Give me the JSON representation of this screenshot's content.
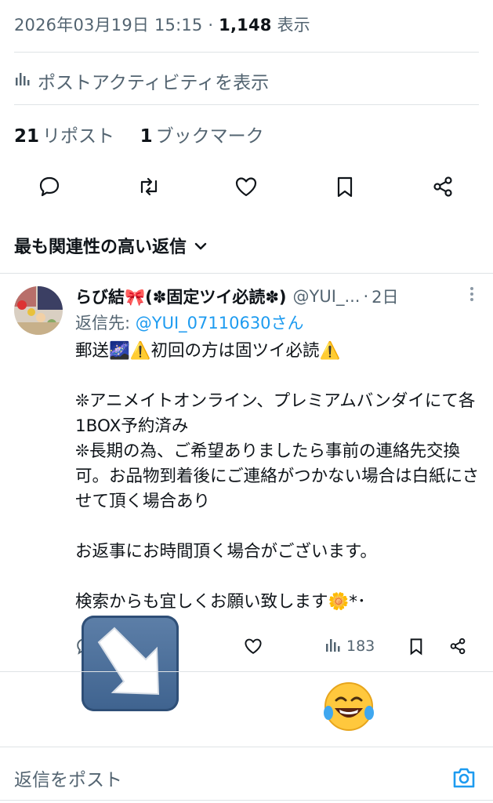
{
  "meta": {
    "datetime": "2026年03月19日 15:15",
    "separator": "·",
    "views_count": "1,148",
    "views_label": "表示"
  },
  "activity_label": "ポストアクティビティを表示",
  "counts": {
    "reposts_count": "21",
    "reposts_label": "リポスト",
    "bookmarks_count": "1",
    "bookmarks_label": "ブックマーク"
  },
  "actions": [
    "reply-icon",
    "repost-icon",
    "like-icon",
    "bookmark-icon",
    "share-icon"
  ],
  "sort_label": "最も関連性の高い返信",
  "reply": {
    "name": "らび結🎀(✽固定ツイ必読✽)",
    "handle": "@YUI_...",
    "dot": "·",
    "age": "2日",
    "reply_to_prefix": "返信先: ",
    "reply_to_handle": "@YUI_07110630さん",
    "lines": [
      "郵送🌌⚠️初回の方は固ツイ必読⚠️",
      "",
      "❊アニメイトオンライン、プレミアムバンダイにて各1BOX予約済み",
      "❊長期の為、ご希望ありましたら事前の連絡先交換可。お品物到着後にご連絡がつかない場合は白紙にさせて頂く場合あり",
      "",
      "お返事にお時間頂く場合がございます。",
      "",
      "検索からも宜しくお願い致します🌼*･"
    ],
    "views": "183"
  },
  "compose_placeholder": "返信をポスト",
  "colors": {
    "text": "#0f1419",
    "secondary": "#536471",
    "accent": "#1d9bf0",
    "divider": "#dfe3e6"
  }
}
